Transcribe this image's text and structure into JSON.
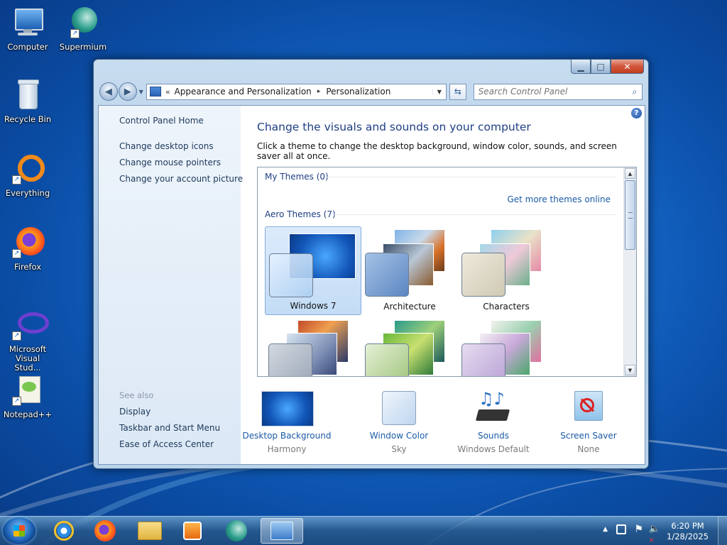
{
  "desktop": {
    "icons": [
      {
        "label": "Computer",
        "icon": "computer-icon"
      },
      {
        "label": "Supermium",
        "icon": "supermium-icon"
      },
      {
        "label": "Recycle Bin",
        "icon": "recycle-bin-icon"
      },
      {
        "label": "Everything",
        "icon": "everything-icon"
      },
      {
        "label": "Firefox",
        "icon": "firefox-icon"
      },
      {
        "label": "Microsoft Visual Stud...",
        "icon": "visual-studio-icon"
      },
      {
        "label": "Notepad++",
        "icon": "notepadpp-icon"
      }
    ]
  },
  "window": {
    "controls": {
      "minimize": "▁",
      "maximize": "□",
      "close": "✕"
    },
    "address": {
      "prefix": "«",
      "crumbs": [
        "Appearance and Personalization",
        "Personalization"
      ],
      "separator": "▸"
    },
    "search": {
      "placeholder": "Search Control Panel"
    }
  },
  "sidebar": {
    "home": "Control Panel Home",
    "links": [
      "Change desktop icons",
      "Change mouse pointers",
      "Change your account picture"
    ],
    "see_also_label": "See also",
    "see_also": [
      "Display",
      "Taskbar and Start Menu",
      "Ease of Access Center"
    ]
  },
  "main": {
    "heading": "Change the visuals and sounds on your computer",
    "description": "Click a theme to change the desktop background, window color, sounds, and screen saver all at once.",
    "my_themes_label": "My Themes (0)",
    "get_more": "Get more themes online",
    "aero_themes_label": "Aero Themes (7)",
    "themes": [
      {
        "name": "Windows 7",
        "selected": true
      },
      {
        "name": "Architecture",
        "selected": false
      },
      {
        "name": "Characters",
        "selected": false
      },
      {
        "name": "",
        "selected": false
      },
      {
        "name": "",
        "selected": false
      },
      {
        "name": "",
        "selected": false
      }
    ]
  },
  "bottom": {
    "items": [
      {
        "title": "Desktop Background",
        "sub": "Harmony",
        "icon": "desktop-background-icon"
      },
      {
        "title": "Window Color",
        "sub": "Sky",
        "icon": "window-color-icon"
      },
      {
        "title": "Sounds",
        "sub": "Windows Default",
        "icon": "sounds-icon"
      },
      {
        "title": "Screen Saver",
        "sub": "None",
        "icon": "screen-saver-icon"
      }
    ]
  },
  "taskbar": {
    "apps": [
      "internet-explorer-icon",
      "firefox-icon",
      "file-explorer-icon",
      "media-player-icon",
      "supermium-icon",
      "control-panel-icon"
    ],
    "active_app": "control-panel-icon",
    "clock": {
      "time": "6:20 PM",
      "date": "1/28/2025"
    },
    "tray_arrow": "▲"
  }
}
